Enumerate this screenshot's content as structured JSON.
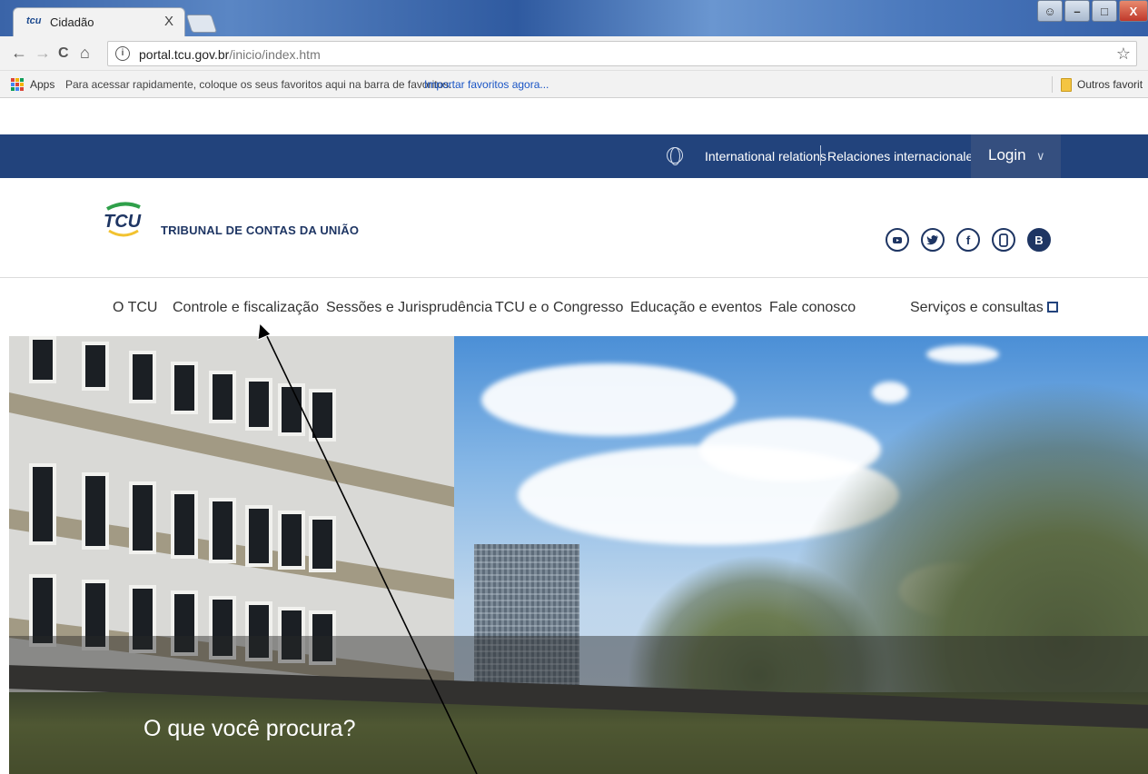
{
  "browser": {
    "tab_title": "Cidadão",
    "tab_favicon": "tcu",
    "tab_close": "X",
    "back": "←",
    "forward": "→",
    "reload": "C",
    "home": "⌂",
    "url_host": "portal.tcu.gov.br",
    "url_path": "/inicio/index.htm",
    "bookmark_star": "☆",
    "bookmarks": {
      "apps_label": "Apps",
      "hint": "Para acessar rapidamente, coloque os seus favoritos aqui na barra de favoritos.",
      "import_link": "Importar favoritos agora...",
      "other": "Outros favorit"
    }
  },
  "site": {
    "topbar": {
      "international_relations": "International relations",
      "relaciones": "Relaciones internacionales",
      "login": "Login"
    },
    "logo_text": "TRIBUNAL DE CONTAS DA UNIÃO",
    "social_icons": [
      "youtube-icon",
      "twitter-icon",
      "facebook-icon",
      "mobile-icon",
      "blogger-icon"
    ],
    "nav": [
      {
        "label": "O TCU"
      },
      {
        "label": "Controle e fiscalização"
      },
      {
        "label": "Sessões e Jurisprudência"
      },
      {
        "label": "TCU e o Congresso"
      },
      {
        "label": "Educação e eventos"
      },
      {
        "label": "Fale conosco"
      },
      {
        "label": "Serviços e consultas"
      }
    ],
    "hero_search_title": "O que você procura?"
  },
  "colors": {
    "topbar": "#22437c",
    "login_bg": "#354f7f",
    "logo_text": "#1e3563",
    "link": "#1a55c5"
  }
}
